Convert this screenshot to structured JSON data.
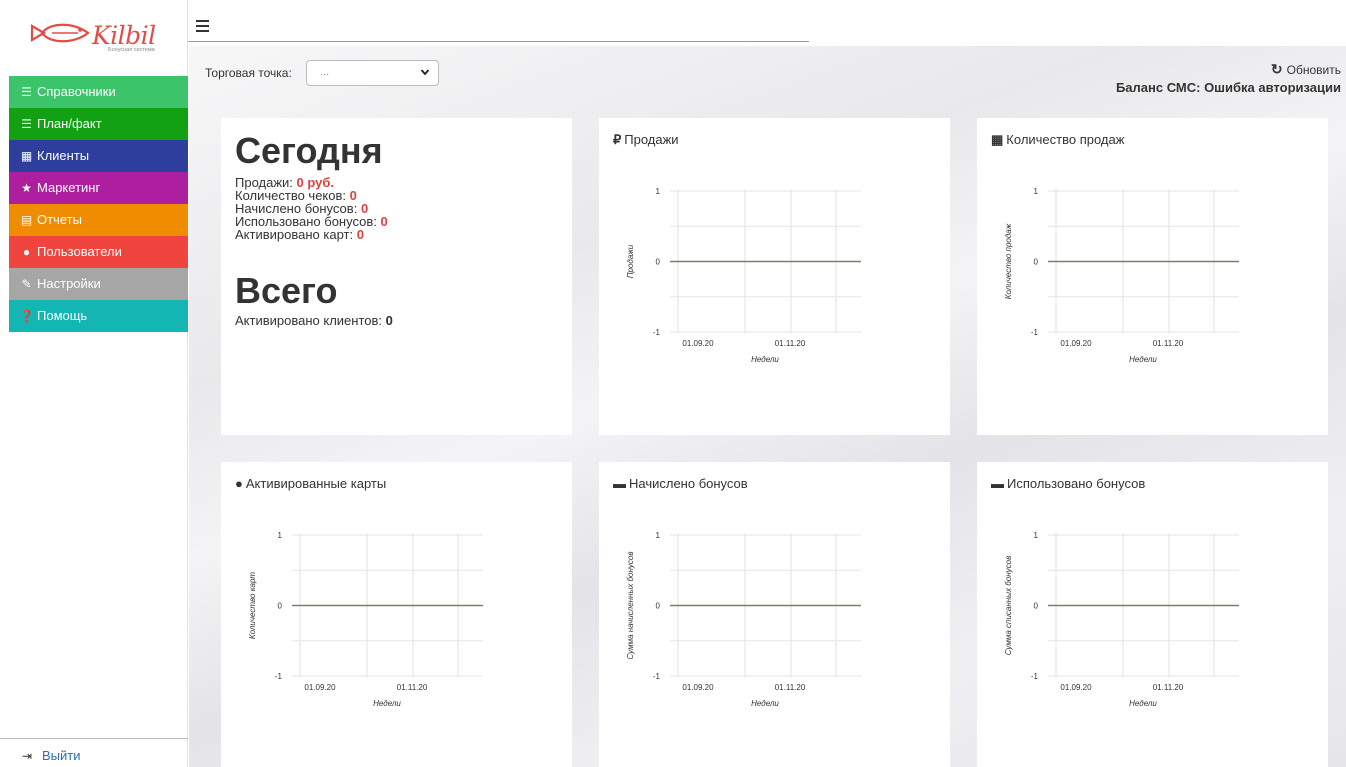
{
  "logo": {
    "text": "Kilbil",
    "subtitle": "Бонусная система"
  },
  "sidebar": {
    "items": [
      {
        "label": "Справочники",
        "icon": "list-icon",
        "glyph": "☰",
        "color": "#3cc46a"
      },
      {
        "label": "План/факт",
        "icon": "list-icon",
        "glyph": "☰",
        "color": "#12a113"
      },
      {
        "label": "Клиенты",
        "icon": "grid-icon",
        "glyph": "▦",
        "color": "#2d3e9c"
      },
      {
        "label": "Маркетинг",
        "icon": "star-icon",
        "glyph": "★",
        "color": "#ad1f9f"
      },
      {
        "label": "Отчеты",
        "icon": "report-icon",
        "glyph": "▤",
        "color": "#f08c00"
      },
      {
        "label": "Пользователи",
        "icon": "user-icon",
        "glyph": "●",
        "color": "#f0443f"
      },
      {
        "label": "Настройки",
        "icon": "wrench-icon",
        "glyph": "✎",
        "color": "#a6a6a6"
      },
      {
        "label": "Помощь",
        "icon": "question-icon",
        "glyph": "❓",
        "color": "#14b6b4"
      }
    ],
    "logout": "Выйти"
  },
  "toolbar": {
    "store_label": "Торговая точка:",
    "store_value": "...",
    "refresh": "Обновить",
    "sms_balance": "Баланс СМС: Ошибка авторизации"
  },
  "today": {
    "title": "Сегодня",
    "sales_label": "Продажи:",
    "sales_value": "0 руб.",
    "checks_label": "Количество чеков:",
    "checks_value": "0",
    "bonus_added_label": "Начислено бонусов:",
    "bonus_added_value": "0",
    "bonus_used_label": "Использовано бонусов:",
    "bonus_used_value": "0",
    "cards_label": "Активировано карт:",
    "cards_value": "0",
    "total_title": "Всего",
    "clients_label": "Активировано клиентов:",
    "clients_value": "0"
  },
  "cards": [
    {
      "title": "Продажи",
      "glyph": "₽",
      "icon": "ruble-icon"
    },
    {
      "title": "Количество продаж",
      "glyph": "▦",
      "icon": "grid-icon"
    },
    {
      "title": "Активированные карты",
      "glyph": "●",
      "icon": "user-icon"
    },
    {
      "title": "Начислено бонусов",
      "glyph": "▬",
      "icon": "card-icon"
    },
    {
      "title": "Использовано бонусов",
      "glyph": "▬",
      "icon": "card-icon"
    }
  ],
  "chart_data": [
    {
      "type": "line",
      "ylabel": "Продажи",
      "xlabel": "Недели",
      "x_ticks": [
        "01.09.20",
        "01.11.20"
      ],
      "y_ticks": [
        "1",
        "0",
        "-1"
      ],
      "ylim": [
        -1,
        1
      ],
      "series": [
        {
          "values": [
            0,
            0
          ]
        }
      ]
    },
    {
      "type": "line",
      "ylabel": "Количество продаж",
      "xlabel": "Недели",
      "x_ticks": [
        "01.09.20",
        "01.11.20"
      ],
      "y_ticks": [
        "1",
        "0",
        "-1"
      ],
      "ylim": [
        -1,
        1
      ],
      "series": [
        {
          "values": [
            0,
            0
          ]
        }
      ]
    },
    {
      "type": "line",
      "ylabel": "Количество карт",
      "xlabel": "Недели",
      "x_ticks": [
        "01.09.20",
        "01.11.20"
      ],
      "y_ticks": [
        "1",
        "0",
        "-1"
      ],
      "ylim": [
        -1,
        1
      ],
      "series": [
        {
          "values": [
            0,
            0
          ]
        }
      ]
    },
    {
      "type": "line",
      "ylabel": "Сумма начисленных бонусов",
      "xlabel": "Недели",
      "x_ticks": [
        "01.09.20",
        "01.11.20"
      ],
      "y_ticks": [
        "1",
        "0",
        "-1"
      ],
      "ylim": [
        -1,
        1
      ],
      "series": [
        {
          "values": [
            0,
            0
          ]
        }
      ]
    },
    {
      "type": "line",
      "ylabel": "Сумма списанных бонусов",
      "xlabel": "Недели",
      "x_ticks": [
        "01.09.20",
        "01.11.20"
      ],
      "y_ticks": [
        "1",
        "0",
        "-1"
      ],
      "ylim": [
        -1,
        1
      ],
      "series": [
        {
          "values": [
            0,
            0
          ]
        }
      ]
    }
  ]
}
